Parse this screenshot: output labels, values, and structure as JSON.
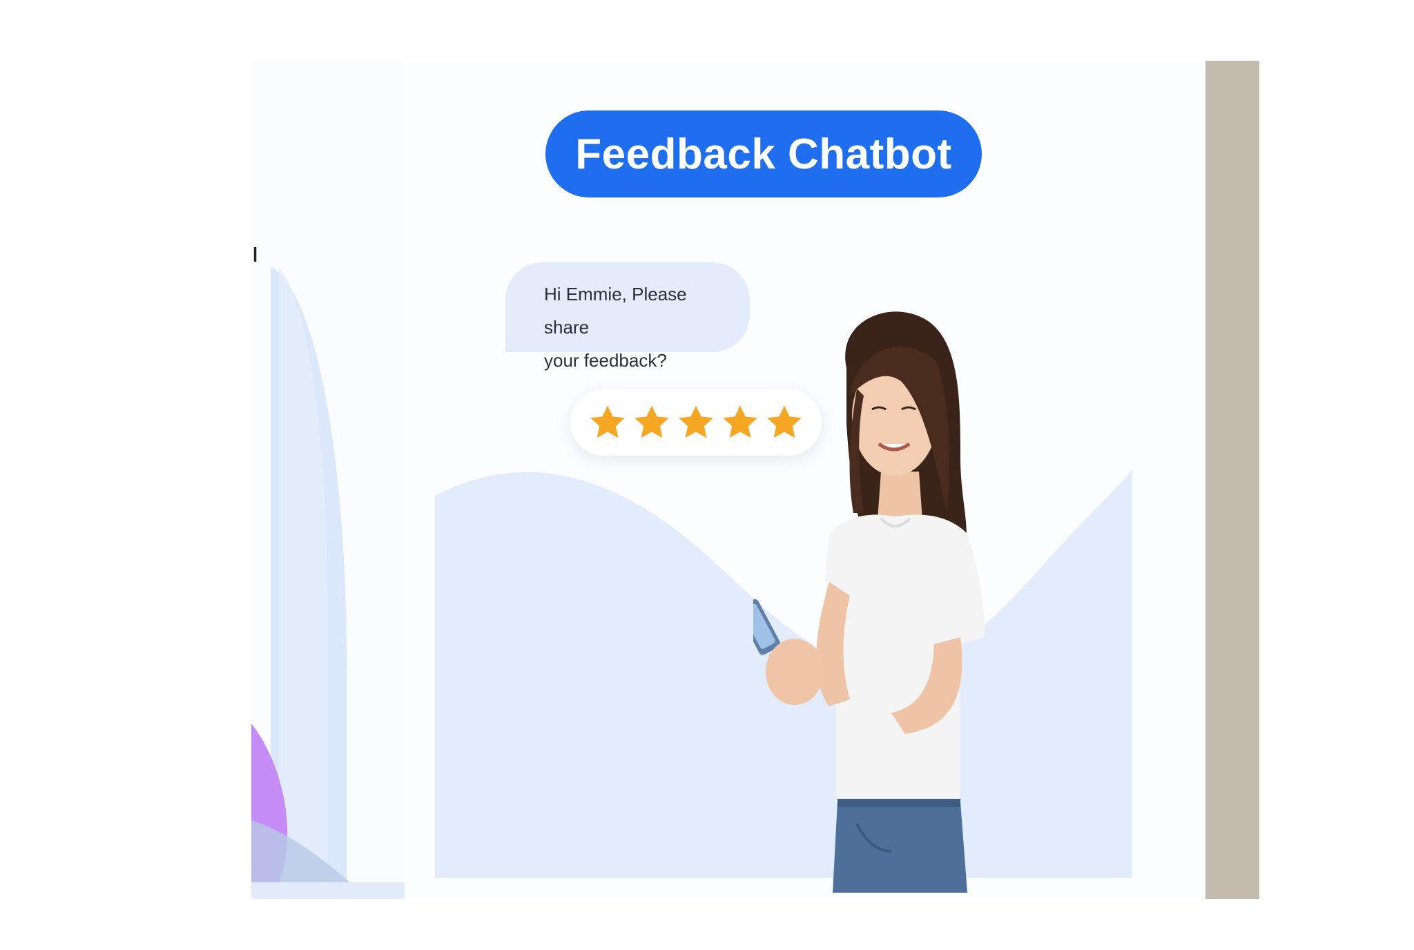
{
  "left_card": {
    "partial_text": "ı"
  },
  "slide": {
    "title": "Feedback Chatbot",
    "chat": {
      "line1": "Hi Emmie, Please share",
      "line2": "your feedback?"
    },
    "rating": {
      "stars": 5,
      "max": 5,
      "star_icon": "star-icon",
      "star_color": "#f5a623"
    },
    "person_image": "woman-with-phone"
  },
  "colors": {
    "title_bg": "#1f6ef0",
    "bubble_bg": "#e4ecfb",
    "wave_bg": "#e3ecfc",
    "right_strip": "#c2bbae",
    "accent_purple": "#c58cf5"
  }
}
